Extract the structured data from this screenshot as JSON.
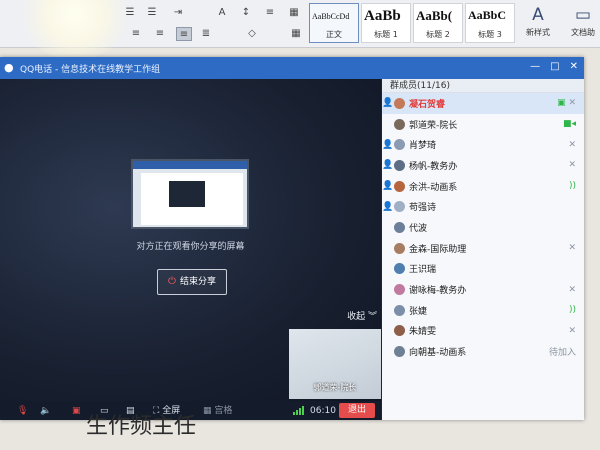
{
  "word": {
    "styles": [
      {
        "sample": "AaBbCcDd",
        "name": "正文"
      },
      {
        "sample": "AaBb",
        "name": "标题 1"
      },
      {
        "sample": "AaBb(",
        "name": "标题 2"
      },
      {
        "sample": "AaBbC",
        "name": "标题 3"
      }
    ],
    "new_style": "新样式",
    "doc_helper": "文档助",
    "doc_text": "生作频主任"
  },
  "qq": {
    "title": "QQ电话 - 信息技术在线教学工作组",
    "end_share": "结束分享",
    "share_status": "对方正在观看你分享的屏幕",
    "collapse": "收起",
    "thumb_name": "郭道荣-院长",
    "toolbar": {
      "fullscreen": "全屏",
      "grid": "宫格",
      "timer": "06:10",
      "exit": "退出"
    }
  },
  "members_panel": {
    "header": "群成员(11/16)",
    "members": [
      {
        "name": "凝石贺睿",
        "status": "speaking",
        "state_icon": "screen-mic-off"
      },
      {
        "name": "郭道荣-院长",
        "status": "",
        "state_icon": "video"
      },
      {
        "name": "肖梦琦",
        "status": "",
        "state_icon": "mic-off"
      },
      {
        "name": "杨帆-教务办",
        "status": "",
        "state_icon": "mic-off"
      },
      {
        "name": "余洪-动画系",
        "status": "",
        "state_icon": "volume"
      },
      {
        "name": "苟强诗",
        "status": "",
        "state_icon": ""
      },
      {
        "name": "代波",
        "status": "",
        "state_icon": ""
      },
      {
        "name": "金森-国际助理",
        "status": "",
        "state_icon": "mic-off"
      },
      {
        "name": "王识瑞",
        "status": "",
        "state_icon": ""
      },
      {
        "name": "谢咏梅-教务办",
        "status": "",
        "state_icon": "mic-off"
      },
      {
        "name": "张婕",
        "status": "",
        "state_icon": "volume"
      },
      {
        "name": "朱婧雯",
        "status": "",
        "state_icon": "mic-off"
      },
      {
        "name": "向朝基-动画系",
        "status": "待加入",
        "state_icon": ""
      }
    ]
  }
}
